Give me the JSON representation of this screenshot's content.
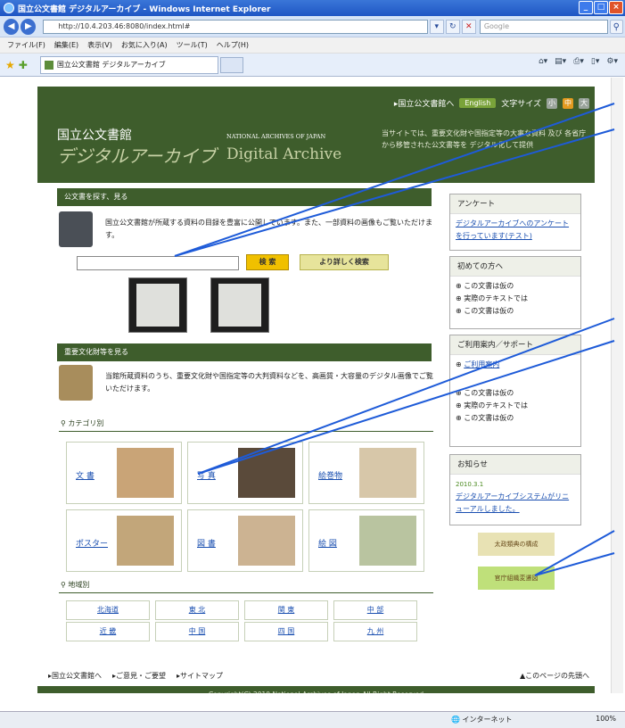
{
  "browser": {
    "title": "国立公文書館 デジタルアーカイブ - Windows Internet Explorer",
    "url": "http://10.4.203.46:8080/index.html#",
    "search_placeholder": "Google",
    "menu": [
      "ファイル(F)",
      "編集(E)",
      "表示(V)",
      "お気に入り(A)",
      "ツール(T)",
      "ヘルプ(H)"
    ],
    "tab_title": "国立公文書館 デジタルアーカイブ",
    "status_zone": "インターネット",
    "zoom": "100%"
  },
  "header": {
    "nav_link": "▸国立公文書館へ",
    "english_btn": "English",
    "fontsize_label": "文字サイズ",
    "fontsize_small": "小",
    "fontsize_medium": "中",
    "fontsize_large": "大",
    "logo_jp_line1": "国立公文書館",
    "logo_jp_line2": "デジタルアーカイブ",
    "logo_en_line1": "NATIONAL ARCHIVES OF JAPAN",
    "logo_en_line2": "Digital Archive",
    "desc": "当サイトでは、重要文化財や国指定等の大事な資料 及び 各省庁から移管された公文書等を デジタル化して提供"
  },
  "search_section": {
    "title": "公文書を探す、見る",
    "text": "国立公文書館が所蔵する資料の目録を豊富に公開しています。また、一部資料の画像もご覧いただけます。",
    "search_button": "検 索",
    "advanced_button": "より詳しく検索"
  },
  "culture_section": {
    "title": "重要文化財等を見る",
    "text": "当館所蔵資料のうち、重要文化財や国指定等の大判資料などを、高画質・大容量のデジタル画像でご覧いただけます。"
  },
  "category": {
    "title": "カテゴリ別",
    "items": [
      "文 書",
      "写 真",
      "絵巻物",
      "ポスター",
      "図 書",
      "絵 図"
    ]
  },
  "region": {
    "title": "地域別",
    "items": [
      "北海道",
      "東 北",
      "関 東",
      "中 部",
      "近 畿",
      "中 国",
      "四 国",
      "九 州"
    ]
  },
  "sidebar": {
    "survey_title": "アンケート",
    "survey_link": "デジタルアーカイブへのアンケートを行っています(テスト)",
    "first_title": "初めての方へ",
    "first_items": [
      "この文書は仮の",
      "実際のテキストでは",
      "この文書は仮の"
    ],
    "guide_title": "ご利用案内／サポート",
    "guide_link": "ご利用案内",
    "guide_items": [
      "この文書は仮の",
      "実際のテキストでは",
      "この文書は仮の"
    ],
    "news_title": "お知らせ",
    "news_date": "2010.3.1",
    "news_link": "デジタルアーカイブシステムがリニューアルしました。",
    "banner1": "太政類典の構成",
    "banner2": "官庁組織変遷図"
  },
  "footer": {
    "link1": "▸国立公文書館へ",
    "link2": "▸ご意見・ご要望",
    "link3": "▸サイトマップ",
    "top_link": "▲このページの先頭へ",
    "copyright": "Copyright(C) 2010 National Archives of Japan All Right Reserved"
  },
  "colors": {
    "header_green": "#3e5d2c",
    "link_blue": "#1a4fb0",
    "search_yellow": "#f0c000",
    "callout_blue": "#1e5bd8"
  }
}
